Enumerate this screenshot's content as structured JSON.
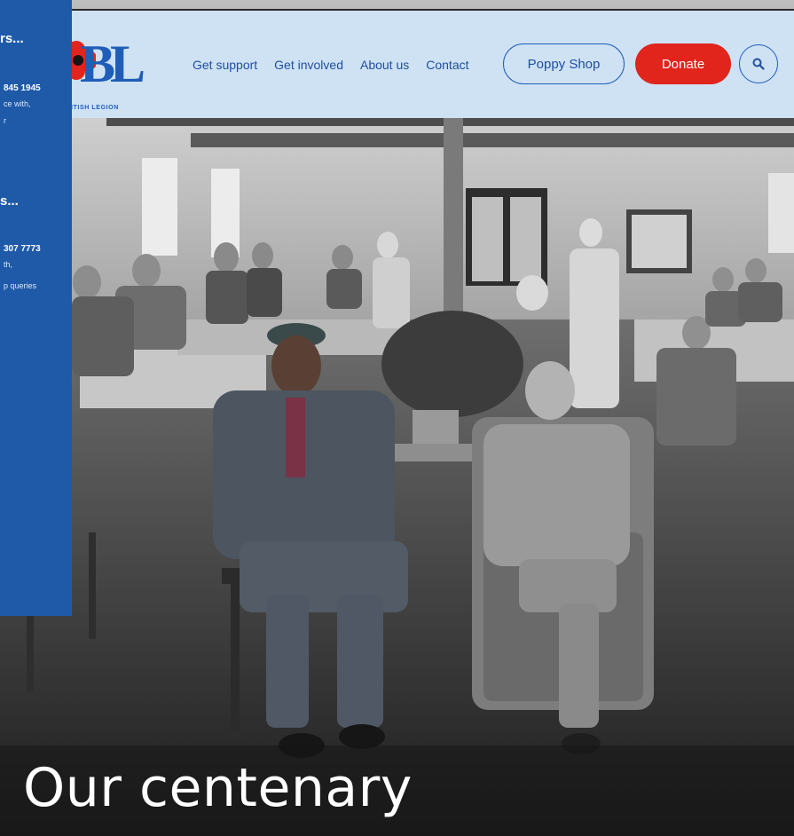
{
  "header": {
    "logo": {
      "letters": "BL",
      "subtitle": "ITISH LEGION",
      "icon": "poppy-icon"
    },
    "nav": [
      {
        "label": "Get support"
      },
      {
        "label": "Get involved"
      },
      {
        "label": "About us"
      },
      {
        "label": "Contact"
      }
    ],
    "poppy_shop_label": "Poppy Shop",
    "donate_label": "Donate",
    "search_icon": "search-icon"
  },
  "side_panel": {
    "heading_1": "rs...",
    "phone_1": "845 1945",
    "line_1a": "ce with,",
    "line_1b": "r",
    "heading_2": "s...",
    "phone_2": "307 7773",
    "line_2a": "th,",
    "line_2b": "p queries"
  },
  "hero": {
    "title": "Our centenary"
  },
  "colors": {
    "header_bg": "#cfe2f3",
    "brand_blue": "#1f5db8",
    "donate_red": "#e1241c",
    "panel_blue": "#1f5aa8"
  }
}
